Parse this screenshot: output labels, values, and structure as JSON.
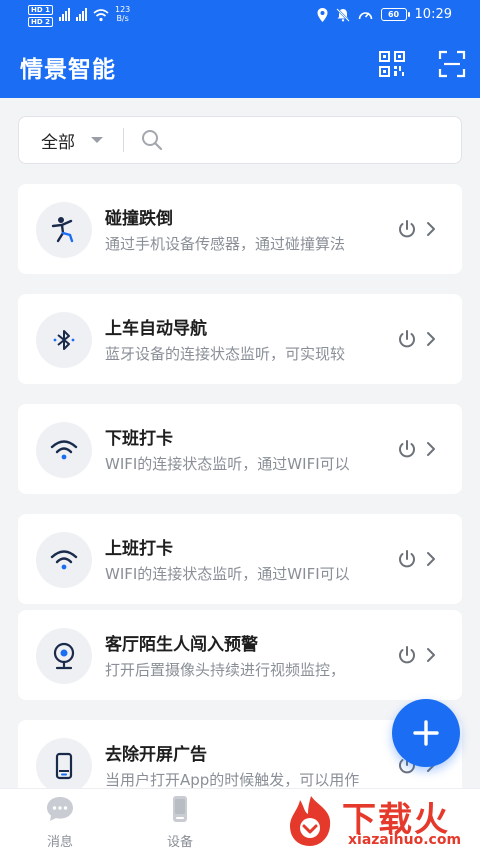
{
  "status_bar": {
    "sim1": "HD 1",
    "sim2": "HD 2",
    "net_speed_value": "123",
    "net_speed_unit": "B/s",
    "battery": "60",
    "time": "10:29"
  },
  "header": {
    "title": "情景智能"
  },
  "search": {
    "filter_label": "全部"
  },
  "scenes": [
    {
      "title": "碰撞跌倒",
      "description": "通过手机设备传感器，通过碰撞算法",
      "icon": "fall-person-icon"
    },
    {
      "title": "上车自动导航",
      "description": "蓝牙设备的连接状态监听，可实现较",
      "icon": "bluetooth-icon"
    },
    {
      "title": "下班打卡",
      "description": "WIFI的连接状态监听，通过WIFI可以",
      "icon": "wifi-icon"
    },
    {
      "title": "上班打卡",
      "description": "WIFI的连接状态监听，通过WIFI可以",
      "icon": "wifi-icon"
    },
    {
      "title": "客厅陌生人闯入预警",
      "description": "打开后置摄像头持续进行视频监控，",
      "icon": "camera-icon"
    },
    {
      "title": "去除开屏广告",
      "description": "当用户打开App的时候触发，可以用作",
      "icon": "phone-icon"
    }
  ],
  "bottom_nav": {
    "messages": "消息",
    "devices": "设备"
  },
  "watermark": {
    "brand": "下载火",
    "domain": "xiazaihuo.com"
  },
  "colors": {
    "primary": "#1b6ef3",
    "icon_blue": "#1b6ef3",
    "watermark": "#e53a2b"
  }
}
